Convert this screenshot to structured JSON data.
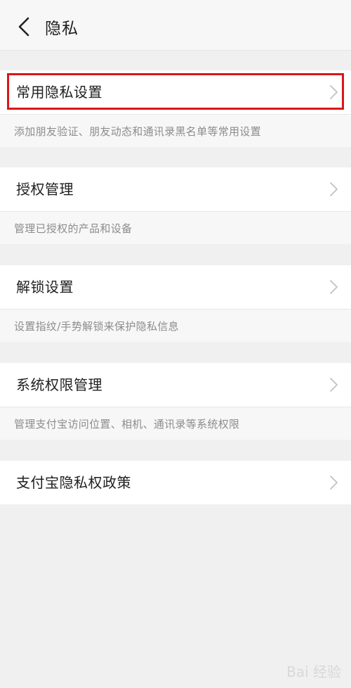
{
  "header": {
    "title": "隐私",
    "back_icon": "chevron-left-icon"
  },
  "rows": [
    {
      "label": "常用隐私设置",
      "description": "添加朋友验证、朋友动态和通讯录黑名单等常用设置"
    },
    {
      "label": "授权管理",
      "description": "管理已授权的产品和设备"
    },
    {
      "label": "解锁设置",
      "description": "设置指纹/手势解锁来保护隐私信息"
    },
    {
      "label": "系统权限管理",
      "description": "管理支付宝访问位置、相机、通讯录等系统权限"
    },
    {
      "label": "支付宝隐私权政策",
      "description": ""
    }
  ],
  "highlight_color": "#d9171a",
  "watermark": "Bai 经验"
}
